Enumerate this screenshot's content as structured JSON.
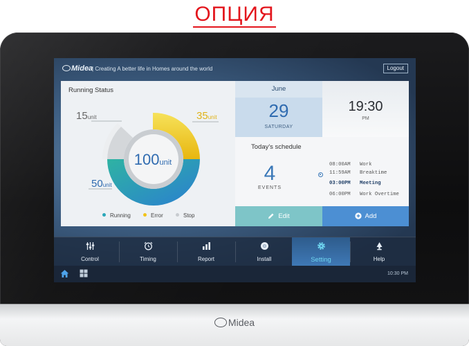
{
  "banner": {
    "text": "ОПЦИЯ"
  },
  "device": {
    "brand": "Midea"
  },
  "topbar": {
    "brand": "Midea",
    "slogan": "Creating A better life in Homes around the world",
    "logout": "Logout"
  },
  "running_status": {
    "title": "Running Status",
    "total_value": "100",
    "total_unit": "unit",
    "running": {
      "value": "50",
      "unit": "unit",
      "label": "Running",
      "color": "#2aa7b9"
    },
    "error": {
      "value": "35",
      "unit": "unit",
      "label": "Error",
      "color": "#f2c318"
    },
    "stop": {
      "value": "15",
      "unit": "unit",
      "label": "Stop",
      "color": "#c8ccd0"
    }
  },
  "date": {
    "month": "June",
    "day": "29",
    "weekday": "SATURDAY"
  },
  "time": {
    "value": "19:30",
    "ampm": "PM"
  },
  "schedule": {
    "title": "Today's schedule",
    "count": "4",
    "count_label": "EVENTS",
    "items": [
      {
        "time": "08:00AM",
        "name": "Work"
      },
      {
        "time": "11:59AM",
        "name": "Breaktime"
      },
      {
        "time": "03:00PM",
        "name": "Meeting",
        "active": true
      },
      {
        "time": "06:00PM",
        "name": "Work Overtime"
      }
    ]
  },
  "actions": {
    "edit": "Edit",
    "add": "Add"
  },
  "nav": [
    {
      "label": "Control",
      "icon": "sliders-icon"
    },
    {
      "label": "Timing",
      "icon": "alarm-clock-icon"
    },
    {
      "label": "Report",
      "icon": "bar-chart-icon"
    },
    {
      "label": "Install",
      "icon": "disc-icon"
    },
    {
      "label": "Setting",
      "icon": "gear-icon",
      "active": true
    },
    {
      "label": "Help",
      "icon": "lamp-icon"
    }
  ],
  "footer": {
    "time": "10:30 PM"
  },
  "colors": {
    "accent": "#4c8fd3",
    "edit": "#7ec5c8",
    "banner": "#e3161d"
  }
}
